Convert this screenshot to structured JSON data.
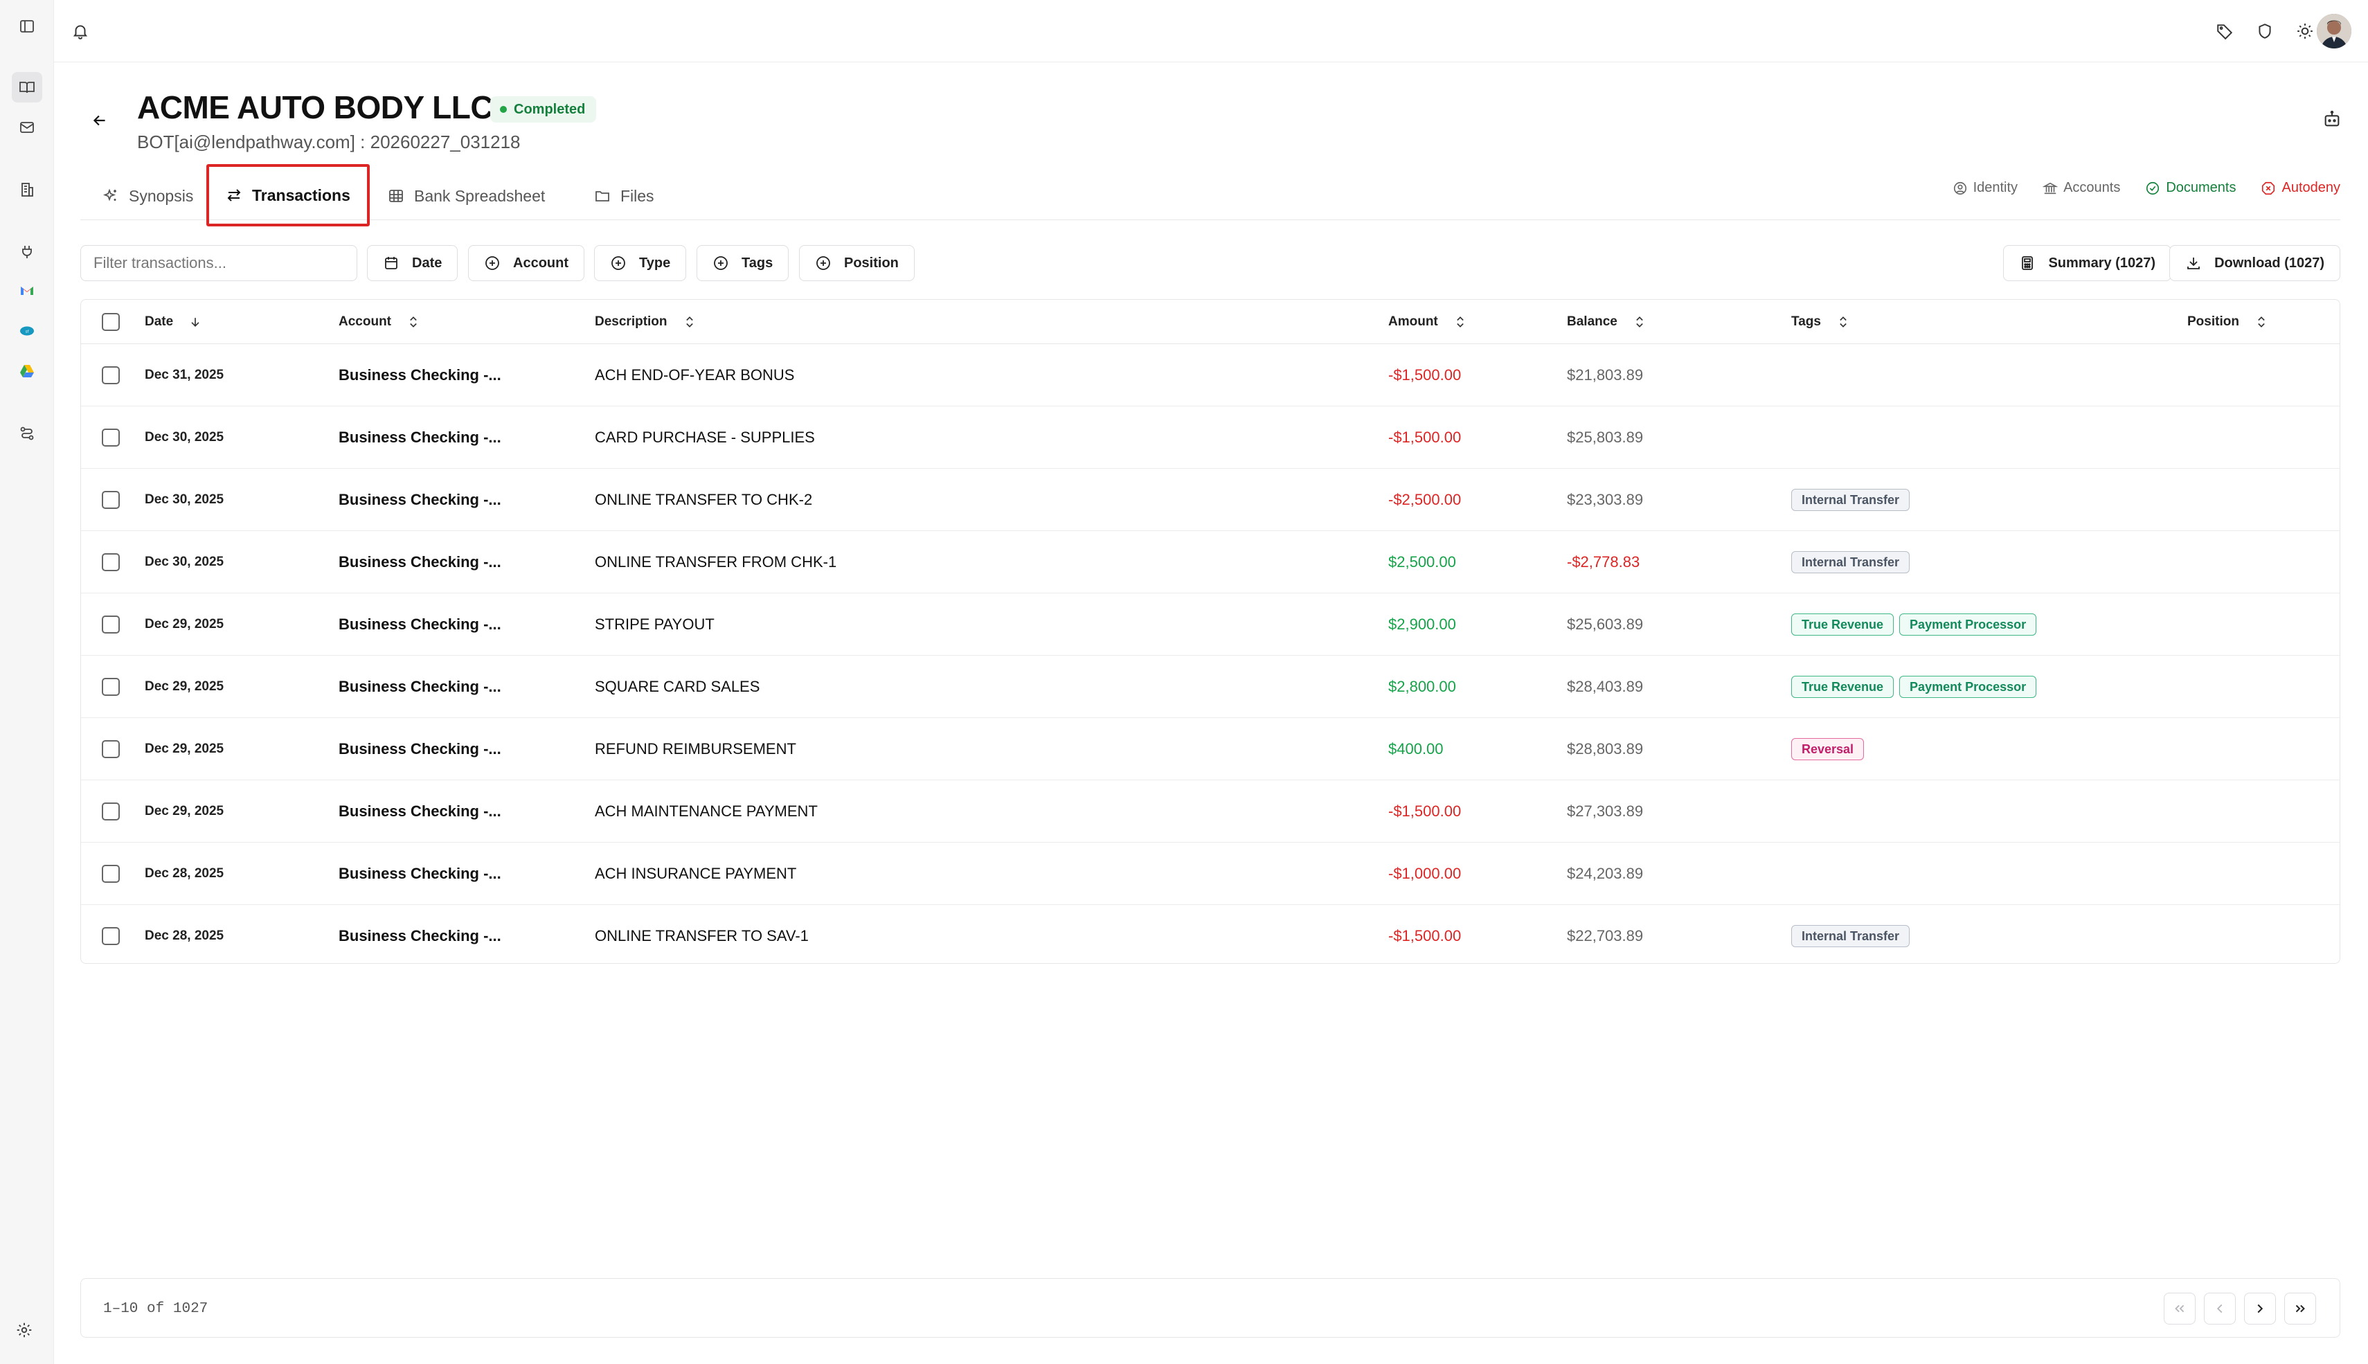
{
  "app": {
    "rail": {
      "icons": [
        "sidebar-toggle-icon",
        "book-icon",
        "mail-icon",
        "building-icon",
        "plug-icon",
        "gmail-icon",
        "salesforce-icon",
        "google-drive-icon",
        "workflow-icon",
        "settings-icon"
      ]
    },
    "topbar": {
      "icons": [
        "bell-icon",
        "tag-icon",
        "shield-icon",
        "sun-icon"
      ]
    }
  },
  "header": {
    "title": "ACME AUTO BODY LLC",
    "status": "Completed",
    "subtitle": "BOT[ai@lendpathway.com] : 20260227_031218"
  },
  "tabs": [
    {
      "label": "Synopsis",
      "icon": "sparkle-icon"
    },
    {
      "label": "Transactions",
      "icon": "arrows-swap-icon",
      "active": true
    },
    {
      "label": "Bank Spreadsheet",
      "icon": "grid-icon"
    },
    {
      "label": "Files",
      "icon": "folder-icon"
    }
  ],
  "status_links": [
    {
      "label": "Identity",
      "color": "#666666"
    },
    {
      "label": "Accounts",
      "color": "#666666"
    },
    {
      "label": "Documents",
      "color": "#15803d"
    },
    {
      "label": "Autodeny",
      "color": "#dc2626"
    }
  ],
  "toolbar": {
    "filter_placeholder": "Filter transactions...",
    "filters": [
      "Date",
      "Account",
      "Type",
      "Tags",
      "Position"
    ],
    "summary_label": "Summary (1027)",
    "download_label": "Download (1027)"
  },
  "table": {
    "columns": [
      "Date",
      "Account",
      "Description",
      "Amount",
      "Balance",
      "Tags",
      "Position"
    ],
    "rows": [
      {
        "date": "Dec 31, 2025",
        "account": "Business Checking -...",
        "description": "ACH END-OF-YEAR BONUS",
        "amount": "-$1,500.00",
        "amount_sign": "neg",
        "balance": "$21,803.89",
        "balance_sign": "pos",
        "tags": []
      },
      {
        "date": "Dec 30, 2025",
        "account": "Business Checking -...",
        "description": "CARD PURCHASE - SUPPLIES",
        "amount": "-$1,500.00",
        "amount_sign": "neg",
        "balance": "$25,803.89",
        "balance_sign": "pos",
        "tags": []
      },
      {
        "date": "Dec 30, 2025",
        "account": "Business Checking -...",
        "description": "ONLINE TRANSFER TO CHK-2",
        "amount": "-$2,500.00",
        "amount_sign": "neg",
        "balance": "$23,303.89",
        "balance_sign": "pos",
        "tags": [
          {
            "label": "Internal Transfer",
            "style": "gray"
          }
        ]
      },
      {
        "date": "Dec 30, 2025",
        "account": "Business Checking -...",
        "description": "ONLINE TRANSFER FROM CHK-1",
        "amount": "$2,500.00",
        "amount_sign": "pos",
        "balance": "-$2,778.83",
        "balance_sign": "neg",
        "tags": [
          {
            "label": "Internal Transfer",
            "style": "gray"
          }
        ]
      },
      {
        "date": "Dec 29, 2025",
        "account": "Business Checking -...",
        "description": "STRIPE PAYOUT",
        "amount": "$2,900.00",
        "amount_sign": "pos",
        "balance": "$25,603.89",
        "balance_sign": "pos",
        "tags": [
          {
            "label": "True Revenue",
            "style": "green"
          },
          {
            "label": "Payment Processor",
            "style": "green"
          }
        ]
      },
      {
        "date": "Dec 29, 2025",
        "account": "Business Checking -...",
        "description": "SQUARE CARD SALES",
        "amount": "$2,800.00",
        "amount_sign": "pos",
        "balance": "$28,403.89",
        "balance_sign": "pos",
        "tags": [
          {
            "label": "True Revenue",
            "style": "green"
          },
          {
            "label": "Payment Processor",
            "style": "green"
          }
        ]
      },
      {
        "date": "Dec 29, 2025",
        "account": "Business Checking -...",
        "description": "REFUND REIMBURSEMENT",
        "amount": "$400.00",
        "amount_sign": "pos",
        "balance": "$28,803.89",
        "balance_sign": "pos",
        "tags": [
          {
            "label": "Reversal",
            "style": "pink"
          }
        ]
      },
      {
        "date": "Dec 29, 2025",
        "account": "Business Checking -...",
        "description": "ACH MAINTENANCE PAYMENT",
        "amount": "-$1,500.00",
        "amount_sign": "neg",
        "balance": "$27,303.89",
        "balance_sign": "pos",
        "tags": []
      },
      {
        "date": "Dec 28, 2025",
        "account": "Business Checking -...",
        "description": "ACH INSURANCE PAYMENT",
        "amount": "-$1,000.00",
        "amount_sign": "neg",
        "balance": "$24,203.89",
        "balance_sign": "pos",
        "tags": []
      },
      {
        "date": "Dec 28, 2025",
        "account": "Business Checking -...",
        "description": "ONLINE TRANSFER TO SAV-1",
        "amount": "-$1,500.00",
        "amount_sign": "neg",
        "balance": "$22,703.89",
        "balance_sign": "pos",
        "tags": [
          {
            "label": "Internal Transfer",
            "style": "gray"
          }
        ]
      }
    ]
  },
  "pagination": {
    "range": "1–10",
    "of_label": "of",
    "total": "1027"
  },
  "colors": {
    "negative": "#dc2626",
    "positive": "#16a34a",
    "highlight_border": "#dc2626"
  }
}
